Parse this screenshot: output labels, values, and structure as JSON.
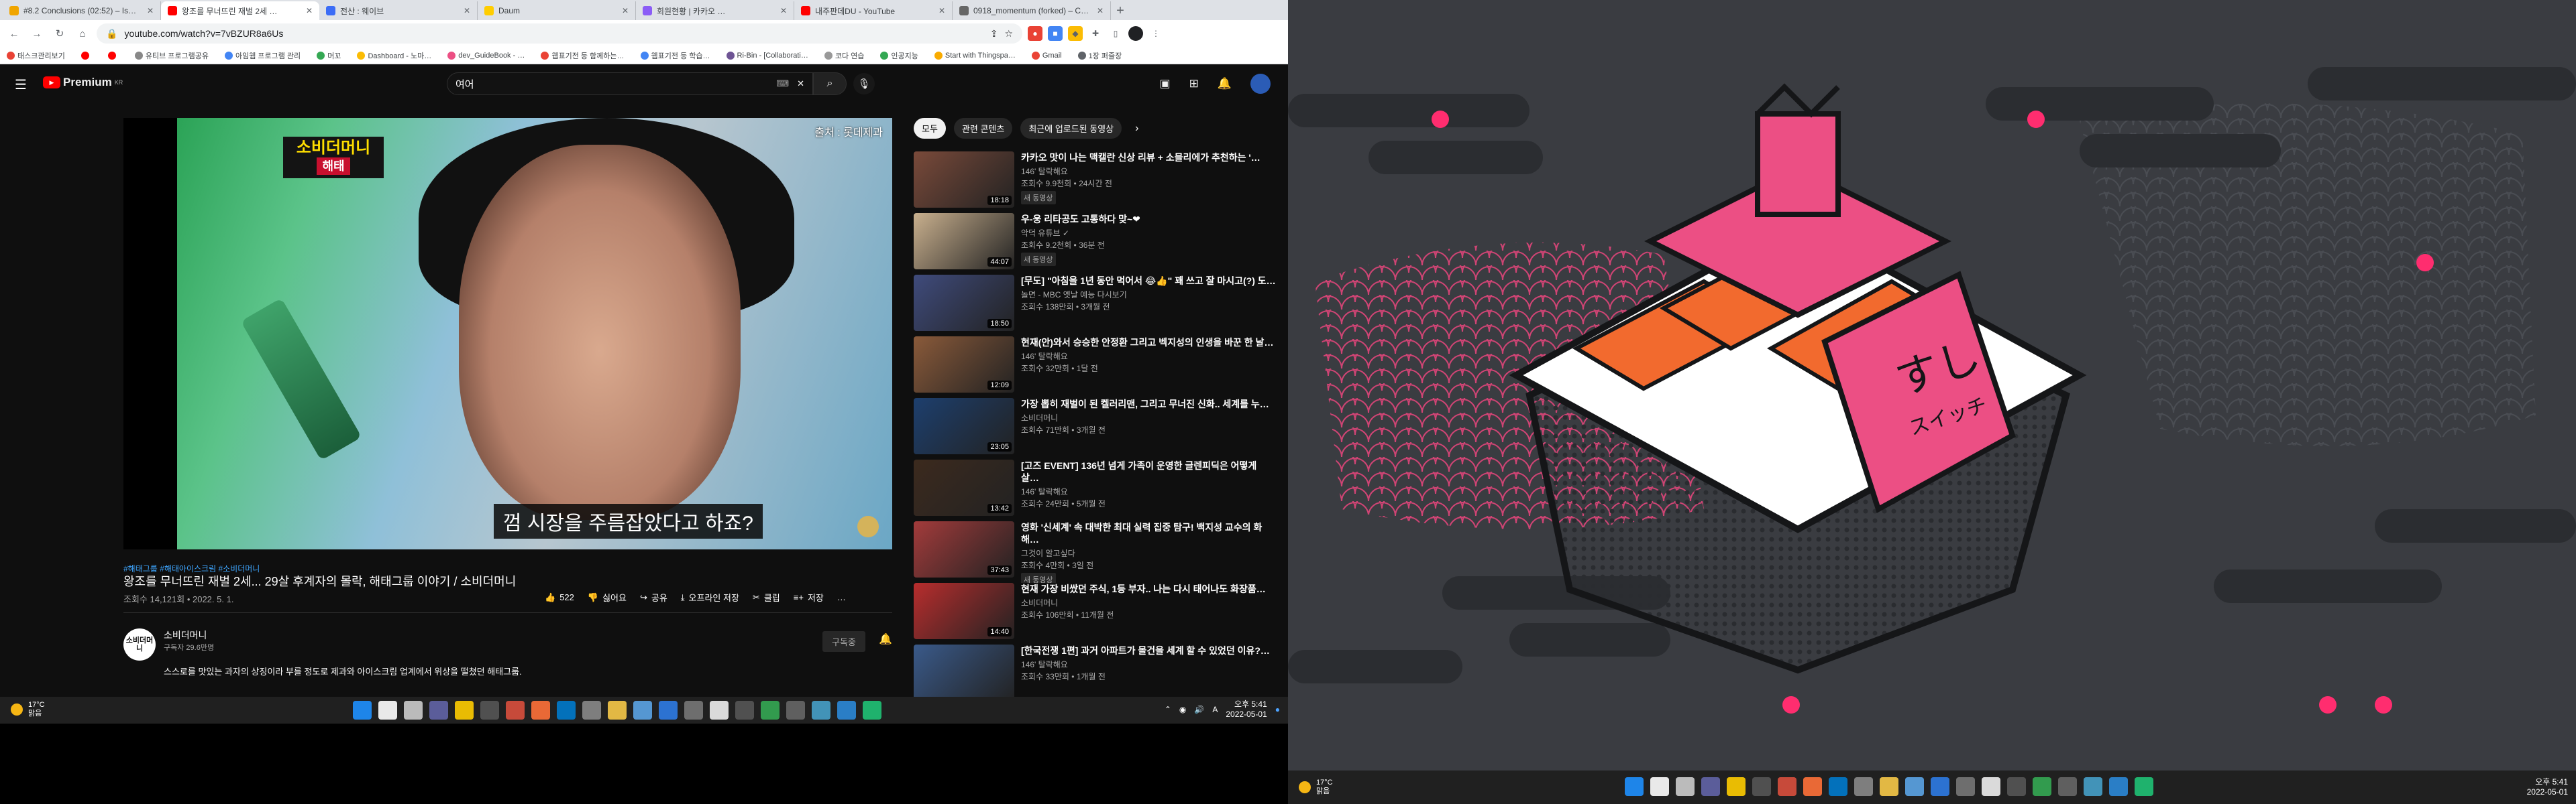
{
  "browser": {
    "tabs": [
      {
        "title": "#8.2 Conclusions (02:52) – Is…",
        "color": "#f0a500"
      },
      {
        "title": "왕조를 무너뜨린 재벌 2세 …",
        "color": "#ff0000",
        "active": true
      },
      {
        "title": "전산 : 웨이브",
        "color": "#3b6cf6"
      },
      {
        "title": "Daum",
        "color": "#ffcd00"
      },
      {
        "title": "회원현황 | 카카오 …",
        "color": "#8b5cf6"
      },
      {
        "title": "내주판데DU - YouTube",
        "color": "#ff0000"
      },
      {
        "title": "0918_momentum (forked) – Co…",
        "color": "#666666"
      }
    ],
    "new_tab": "+",
    "url": "youtube.com/watch?v=7vBZUR8a6Us",
    "bookmarks": [
      "태스크관리보기",
      "",
      "",
      "유티브 프로그램공유",
      "아임웹 프로그램 관리",
      "머꼬",
      "Dashboard - 노마…",
      "dev_GuideBook - …",
      "웹표기전 등 함께하는…",
      "웹표기전 등 학습…",
      "Ri-Bin - [Collaborati…",
      "코다 연습",
      "인공지능",
      "Start with Thingspa…",
      "Gmail",
      "1장 퍼즐장"
    ]
  },
  "youtube": {
    "logo_text": "Premium",
    "logo_sup": "KR",
    "search_value": "여어",
    "video": {
      "source_label": "출처 : 롯데제과",
      "watermark_line1": "소비더머니",
      "watermark_line2": "해태",
      "subtitle": "껌 시장을 주름잡았다고 하죠?"
    },
    "hashtags": "#해태그룹 #해태아이스크림 #소비더머니",
    "title": "왕조를 무너뜨린 재벌 2세... 29살 후계자의 몰락, 해태그룹 이야기 / 소비더머니",
    "meta": "조회수 14,121회 • 2022. 5. 1.",
    "actions": {
      "like": "522",
      "dislike": "싫어요",
      "share": "공유",
      "offline": "오프라인 저장",
      "clip": "클립",
      "save": "저장",
      "more": "…"
    },
    "channel": {
      "name": "소비더머니",
      "subs": "구독자 29.6만명",
      "avatar_text": "소비더머니",
      "subscribe": "구독중"
    },
    "description": "스스로를 맛있는 과자의 상징이라 부를 정도로 제과와 아이스크림 업계에서 위상을 떨쳤던 해태그룹."
  },
  "sidebar": {
    "chips": [
      "모두",
      "관련 콘텐츠",
      "최근에 업로드된 동영상"
    ],
    "items": [
      {
        "title": "카카오 맛이 나는 맥캘란 신상 리뷰 + 소믈리에가 추천하는 '…",
        "channel": "146' 탈락해요",
        "views": "조회수 9.9천회 • 24시간 전",
        "badge": "새 동영상",
        "duration": "18:18",
        "color": "#7a4a3a"
      },
      {
        "title": "우-웅 리타공도 고통하다 맞~❤",
        "channel": "악덕 유튜브 ✓",
        "views": "조회수 9.2천회 • 36분 전",
        "badge": "새 동영상",
        "duration": "44:07",
        "color": "#c9b08e"
      },
      {
        "title": "[무도] \"아침을 1년 동안 먹어서 😂👍\" 꽤 쓰고 잘 마시고(?) 도…",
        "channel": "놀면 - MBC 옛날 예능 다시보기",
        "views": "조회수 138만회 • 3개월 전",
        "badge": "",
        "duration": "18:50",
        "color": "#3f4b7c"
      },
      {
        "title": "현재(안)와서 승승한 안정환 그리고 벡지성의 인생을 바꾼 한 날…",
        "channel": "146' 탈락해요",
        "views": "조회수 32만회 • 1달 전",
        "badge": "",
        "duration": "12:09",
        "color": "#8a5a3a"
      },
      {
        "title": "가장 뽑히 재벌이 된 켈러리맨, 그리고 무너진 신화.. 세계를 누…",
        "channel": "소비더머니",
        "views": "조회수 71만회 • 3개월 전",
        "badge": "",
        "duration": "23:05",
        "color": "#1d3f6e"
      },
      {
        "title": "[고즈 EVENT] 136년 넘게 가족이 운영한 글렌피딕은 어떻게 살…",
        "channel": "146' 탈락해요",
        "views": "조회수 24만회 • 5개월 전",
        "badge": "",
        "duration": "13:42",
        "color": "#3c2a1e"
      },
      {
        "title": "영화 '신세계' 속 대박한 최대 실력 집중 탐구! 백지성 교수의 화해…",
        "channel": "그것이 알고싶다",
        "views": "조회수 4만회 • 3일 전",
        "badge": "새 동영상",
        "duration": "37:43",
        "color": "#a33b3b"
      },
      {
        "title": "현재 가장 비쌌던 주식, 1등 부자.. 나는 다시 태어나도 화장품…",
        "channel": "소비더머니",
        "views": "조회수 106만회 • 11개월 전",
        "badge": "",
        "duration": "14:40",
        "color": "#b82d2d"
      },
      {
        "title": "[한국전쟁 1편] 과거 아파트가 몰건을 세계 할 수 있었던 이유?…",
        "channel": "146' 탈락해요",
        "views": "조회수 33만회 • 1개월 전",
        "badge": "",
        "duration": "",
        "color": "#3a5a8a"
      }
    ]
  },
  "taskbar": {
    "weather_temp": "17°C",
    "weather_desc": "맑음",
    "time": "오후 5:41",
    "date": "2022-05-01",
    "icons": [
      {
        "name": "windows-start-icon",
        "color": "#1e90ff"
      },
      {
        "name": "search-icon",
        "color": "#ffffff"
      },
      {
        "name": "task-view-icon",
        "color": "#cccccc"
      },
      {
        "name": "teams-icon",
        "color": "#6264a7"
      },
      {
        "name": "kakaotalk-icon",
        "color": "#ffcd00"
      },
      {
        "name": "app-icon",
        "color": "#555555"
      },
      {
        "name": "app-icon",
        "color": "#d94f3d"
      },
      {
        "name": "firefox-icon",
        "color": "#ff7139"
      },
      {
        "name": "vscode-icon",
        "color": "#007acc"
      },
      {
        "name": "app-icon",
        "color": "#888888"
      },
      {
        "name": "file-explorer-icon",
        "color": "#f7c948"
      },
      {
        "name": "photos-icon",
        "color": "#5ba4e6"
      },
      {
        "name": "maps-icon",
        "color": "#2d7be4"
      },
      {
        "name": "app-icon",
        "color": "#777777"
      },
      {
        "name": "notion-icon",
        "color": "#eeeeee"
      },
      {
        "name": "terminal-icon",
        "color": "#555555"
      },
      {
        "name": "chrome-icon",
        "color": "#34a853"
      },
      {
        "name": "app-icon",
        "color": "#666666"
      },
      {
        "name": "app-icon",
        "color": "#46a0c9"
      },
      {
        "name": "app-icon",
        "color": "#2b88d8"
      },
      {
        "name": "app-icon",
        "color": "#1fc275"
      }
    ]
  },
  "desktop": {
    "sushi_text": "すし",
    "sushi_sub": "スイッチ",
    "accent": "#ff2d6f"
  }
}
